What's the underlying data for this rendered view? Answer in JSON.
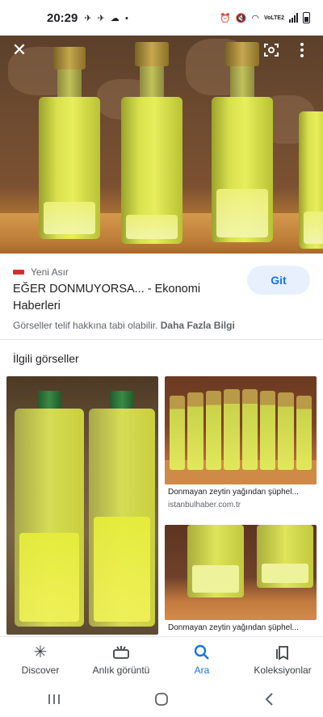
{
  "status_bar": {
    "time": "20:29",
    "notifications": "✈ ✈ ☁ •",
    "lte_label": "VoLTE2"
  },
  "hero": {
    "icons": [
      "close-icon",
      "lens-icon",
      "more-vert-icon"
    ]
  },
  "result": {
    "source_name": "Yeni Asır",
    "title": "EĞER DONMUYORSA... - Ekonomi Haberleri",
    "visit_button": "Git",
    "copyright_text": "Görseller telif hakkına tabi olabilir.",
    "more_info_link": "Daha Fazla Bilgi"
  },
  "related": {
    "heading": "İlgili görseller",
    "items": [
      {
        "caption": "",
        "domain": ""
      },
      {
        "caption": "Donmayan zeytin yağından şüphel...",
        "domain": "istanbulhaber.com.tr"
      },
      {
        "caption": "Donmayan zeytin yağından şüphel...",
        "domain": ""
      }
    ]
  },
  "bottom_nav": {
    "items": [
      {
        "label": "Discover",
        "icon": "asterisk-icon",
        "active": false
      },
      {
        "label": "Anlık görüntü",
        "icon": "snapshot-icon",
        "active": false
      },
      {
        "label": "Ara",
        "icon": "search-icon",
        "active": true
      },
      {
        "label": "Koleksiyonlar",
        "icon": "collections-icon",
        "active": false
      }
    ]
  },
  "colors": {
    "accent": "#1a73e8",
    "visit_button_bg": "#e8f0fe",
    "text_primary": "#202124",
    "text_secondary": "#5f6368"
  }
}
